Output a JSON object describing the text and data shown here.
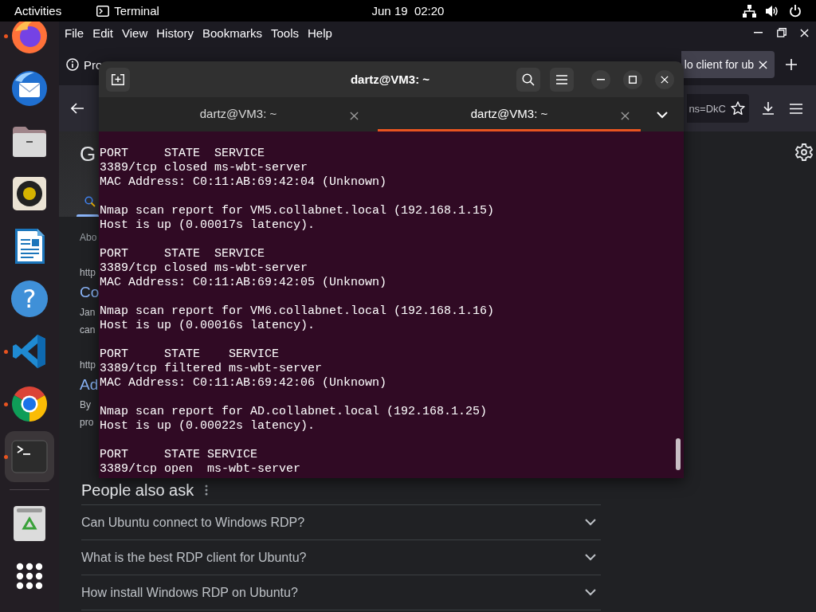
{
  "top_bar": {
    "activities": "Activities",
    "app_name": "Terminal",
    "clock": "Jun 19  02:20"
  },
  "dock": {
    "items": [
      {
        "kind": "firefox",
        "running": true,
        "selected": false
      },
      {
        "kind": "mail",
        "running": false,
        "selected": false
      },
      {
        "kind": "files",
        "running": false,
        "selected": false
      },
      {
        "kind": "music",
        "running": false,
        "selected": false
      },
      {
        "kind": "writer",
        "running": false,
        "selected": false
      },
      {
        "kind": "help",
        "glyph": "?",
        "running": false,
        "selected": false
      },
      {
        "kind": "editor",
        "running": true,
        "selected": false
      },
      {
        "kind": "chrome",
        "running": true,
        "selected": false
      },
      {
        "kind": "terminal",
        "running": true,
        "selected": true
      },
      {
        "kind": "separator"
      },
      {
        "kind": "trash",
        "running": false,
        "selected": false
      },
      {
        "kind": "apps",
        "running": false,
        "selected": false
      }
    ]
  },
  "firefox": {
    "menu": [
      "File",
      "Edit",
      "View",
      "History",
      "Bookmarks",
      "Tools",
      "Help"
    ],
    "tabs": [
      {
        "label": "Pro",
        "selected": false
      },
      {
        "label": "lo client for ub",
        "selected": true
      }
    ],
    "url_fragment": "ns=DkC",
    "results": {
      "logo": "G",
      "about": "Abo",
      "items": [
        {
          "url": "http",
          "title": "Co",
          "snippet": [
            "Jan",
            "can"
          ]
        },
        {
          "url": "http",
          "title": "Ad",
          "snippet": [
            "By",
            "pro"
          ]
        }
      ]
    },
    "people_also_ask": {
      "title": "People also ask",
      "questions": [
        {
          "text": "Can Ubuntu connect to Windows RDP?",
          "expanded": false
        },
        {
          "text": "What is the best RDP client for Ubuntu?",
          "expanded": false
        },
        {
          "text": "How install Windows RDP on Ubuntu?",
          "expanded": false
        }
      ]
    }
  },
  "terminal": {
    "title": "dartz@VM3: ~",
    "tabs": [
      {
        "label": "dartz@VM3: ~",
        "selected": false
      },
      {
        "label": "dartz@VM3: ~",
        "selected": true
      }
    ],
    "blocks": [
      [
        "PORT     STATE  SERVICE",
        "3389/tcp closed ms-wbt-server",
        "MAC Address: C0:11:AB:69:42:04 (Unknown)"
      ],
      [
        "Nmap scan report for VM5.collabnet.local (192.168.1.15)",
        "Host is up (0.00017s latency)."
      ],
      [
        "PORT     STATE  SERVICE",
        "3389/tcp closed ms-wbt-server",
        "MAC Address: C0:11:AB:69:42:05 (Unknown)"
      ],
      [
        "Nmap scan report for VM6.collabnet.local (192.168.1.16)",
        "Host is up (0.00016s latency)."
      ],
      [
        "PORT     STATE    SERVICE",
        "3389/tcp filtered ms-wbt-server",
        "MAC Address: C0:11:AB:69:42:06 (Unknown)"
      ],
      [
        "Nmap scan report for AD.collabnet.local (192.168.1.25)",
        "Host is up (0.00022s latency)."
      ],
      [
        "PORT     STATE SERVICE",
        "3389/tcp open  ms-wbt-server"
      ]
    ]
  }
}
